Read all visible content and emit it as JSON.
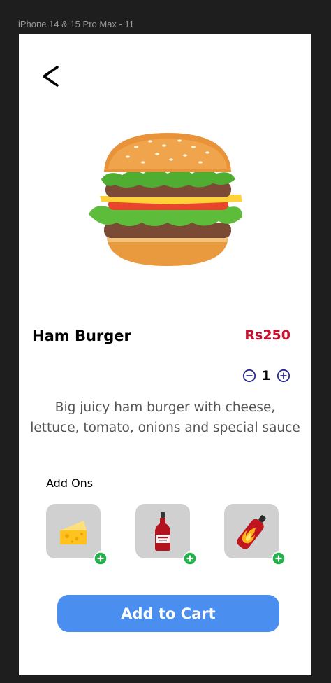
{
  "frame": {
    "label": "iPhone 14 & 15 Pro Max - 11"
  },
  "product": {
    "name": "Ham Burger",
    "price": "Rs250",
    "quantity": "1",
    "description_lines": [
      "Big juicy ham burger with cheese,",
      "lettuce, tomato, onions and special sauce"
    ]
  },
  "addons": {
    "label": "Add Ons",
    "items": [
      {
        "icon": "cheese-icon"
      },
      {
        "icon": "ketchup-bottle-icon"
      },
      {
        "icon": "hot-sauce-icon"
      }
    ]
  },
  "cart": {
    "label": "Add to Cart"
  },
  "colors": {
    "price": "#c8102e",
    "qty_controls": "#2b2b8f",
    "add_green": "#22b24c",
    "cart_button": "#4a8ef0"
  }
}
